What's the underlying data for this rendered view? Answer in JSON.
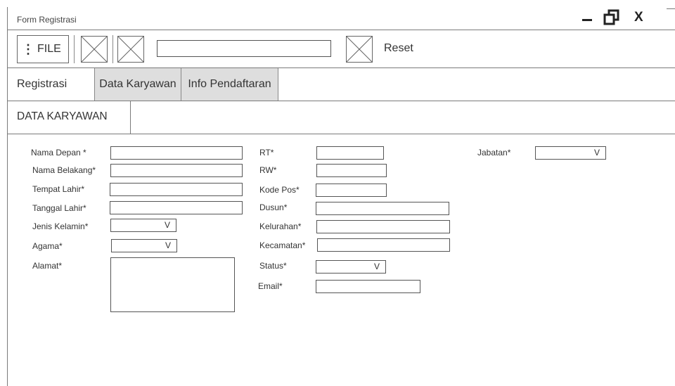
{
  "window": {
    "title": "Form Registrasi",
    "close_label": "X"
  },
  "toolbar": {
    "file_label": "FILE",
    "search_value": "",
    "reset_label": "Reset"
  },
  "tabs": [
    {
      "label": "Registrasi"
    },
    {
      "label": "Data Karyawan"
    },
    {
      "label": "Info Pendaftaran"
    }
  ],
  "section": {
    "title": "DATA KARYAWAN"
  },
  "form": {
    "left": {
      "nama_depan": "Nama Depan *",
      "nama_belakang": "Nama Belakang*",
      "tempat_lahir": "Tempat Lahir*",
      "tanggal_lahir": "Tanggal Lahir*",
      "jenis_kelamin": "Jenis Kelamin*",
      "agama": "Agama*",
      "alamat": "Alamat*"
    },
    "middle": {
      "rt": "RT*",
      "rw": "RW*",
      "kode_pos": "Kode Pos*",
      "dusun": "Dusun*",
      "kelurahan": "Kelurahan*",
      "kecamatan": "Kecamatan*",
      "status": "Status*",
      "email": "Email*"
    },
    "right": {
      "jabatan": "Jabatan*"
    },
    "dropdown_indicator": "V"
  }
}
